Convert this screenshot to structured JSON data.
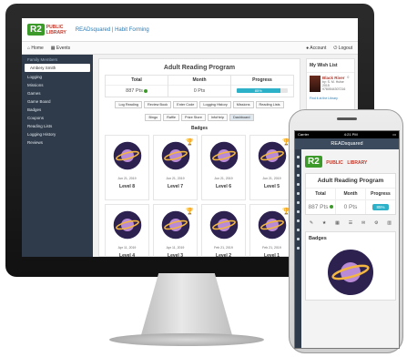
{
  "app": {
    "logo_r2": "R2",
    "logo_line1": "PUBLIC",
    "logo_line2": "LIBRARY",
    "title": "READsquared | Habit Forming"
  },
  "nav": {
    "home": "Home",
    "events": "Events",
    "account": "Account",
    "logout": "Logout"
  },
  "sidebar": {
    "items": [
      {
        "label": "Family Members"
      },
      {
        "label": "Ambery Smith",
        "active": true
      },
      {
        "label": "Logging"
      },
      {
        "label": "Missions"
      },
      {
        "label": "Games"
      },
      {
        "label": "Game Board"
      },
      {
        "label": "Badges"
      },
      {
        "label": "Coupons"
      },
      {
        "label": "Reading Lists"
      },
      {
        "label": "Logging History"
      },
      {
        "label": "Reviews"
      }
    ]
  },
  "main": {
    "title": "Adult Reading Program",
    "stats": [
      {
        "label": "Total",
        "value": "887 Pts"
      },
      {
        "label": "Month",
        "value": "0 Pts"
      },
      {
        "label": "Progress",
        "value": "85%"
      }
    ],
    "progress": 0.85,
    "tabs_row1": [
      "Log Reading",
      "Review Book",
      "Enter Code",
      "Logging History",
      "Missions",
      "Reading Lists"
    ],
    "tabs_row2": [
      "Bingo",
      "Raffle",
      "Prize Store",
      "InfoHelp",
      "Dashboard"
    ],
    "badges_title": "Badges",
    "badges": [
      {
        "date": "Jun 21, 2019",
        "level": "Level 8"
      },
      {
        "date": "Jun 21, 2019",
        "level": "Level 7"
      },
      {
        "date": "Jun 21, 2019",
        "level": "Level 6"
      },
      {
        "date": "Jun 21, 2019",
        "level": "Level 5"
      },
      {
        "date": "Apr 11, 2019",
        "level": "Level 4"
      },
      {
        "date": "Apr 11, 2019",
        "level": "Level 3"
      },
      {
        "date": "Feb 21, 2019",
        "level": "Level 2"
      },
      {
        "date": "Feb 21, 2019",
        "level": "Level 1"
      }
    ]
  },
  "wishlist": {
    "title": "My Wish List",
    "book_title": "Black River",
    "book_author": "by: S. M. Hulse",
    "book_year": "2015",
    "book_isbn": "9780544307216",
    "count": "0",
    "link": "Find it at the Library"
  },
  "phone": {
    "carrier": "Carrier",
    "time": "4:21 PM",
    "nav_title": "READsquared",
    "card_title": "Adult Reading Program",
    "stats": [
      {
        "label": "Total",
        "value": "887 Pts"
      },
      {
        "label": "Month",
        "value": "0 Pts"
      },
      {
        "label": "Progress",
        "value": "85%"
      }
    ],
    "badges_title": "Badges"
  },
  "colors": {
    "accent": "#2cb1c9",
    "sidebar": "#2f3b4a",
    "brand_green": "#3c9a2a"
  }
}
